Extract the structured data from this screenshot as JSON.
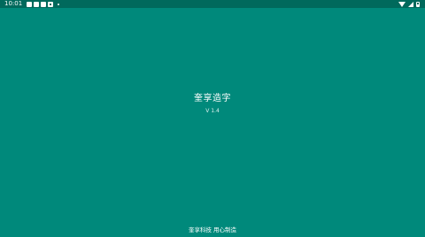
{
  "status_bar": {
    "time": "10:01",
    "icons": [
      "notification-icon",
      "notification-icon",
      "notification-icon",
      "notification-icon",
      "dot-icon",
      "wifi-icon",
      "cell-signal-icon",
      "battery-icon"
    ]
  },
  "splash": {
    "title": "奎享造字",
    "version": "V 1.4",
    "footer": "奎享科技 用心制造"
  },
  "colors": {
    "background": "#00897b",
    "status_bar": "#00695c",
    "text": "#ffffff"
  }
}
